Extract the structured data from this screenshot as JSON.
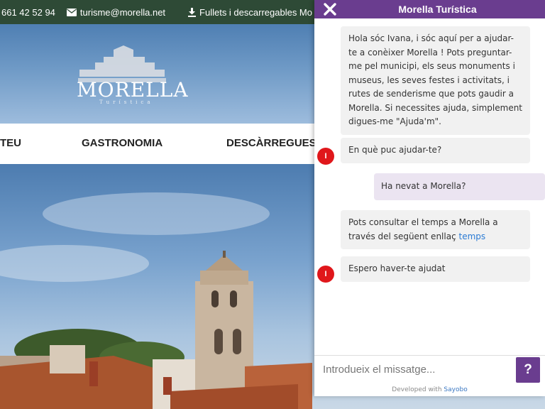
{
  "topbar": {
    "phone": "661 42 52 94",
    "email": "turisme@morella.net",
    "downloads": "Fullets i descarregables Mo"
  },
  "logo": {
    "name": "MORELLA",
    "tagline": "Turística"
  },
  "nav": {
    "items": [
      "TEU",
      "GASTRONOMIA",
      "DESCÀRREGUES"
    ]
  },
  "chat": {
    "title": "Morella Turística",
    "bot_avatar_letter": "I",
    "messages": [
      {
        "from": "bot",
        "text": "Hola sóc Ivana, i sóc aquí per a ajudar-te a conèixer Morella ! Pots preguntar-me pel municipi, els seus monuments i museus, les seves festes i activitats, i rutes de senderisme que pots gaudir a Morella. Si necessites ajuda, simplement digues-me \"Ajuda'm\"."
      },
      {
        "from": "bot",
        "text": "En què puc ajudar-te?"
      },
      {
        "from": "user",
        "text": "Ha nevat a Morella?"
      },
      {
        "from": "bot",
        "text": "Pots consultar el temps a Morella a través del següent enllaç",
        "link": "temps"
      },
      {
        "from": "bot",
        "text": "Espero haver-te ajudat"
      }
    ],
    "input_placeholder": "Introdueix el missatge...",
    "help_label": "?",
    "developed_with": "Developed with",
    "developer": "Sayobo"
  },
  "colors": {
    "topbar": "#2e4a36",
    "chat_header": "#6a3d8f",
    "avatar": "#e0171b",
    "link": "#2b7bd4"
  }
}
